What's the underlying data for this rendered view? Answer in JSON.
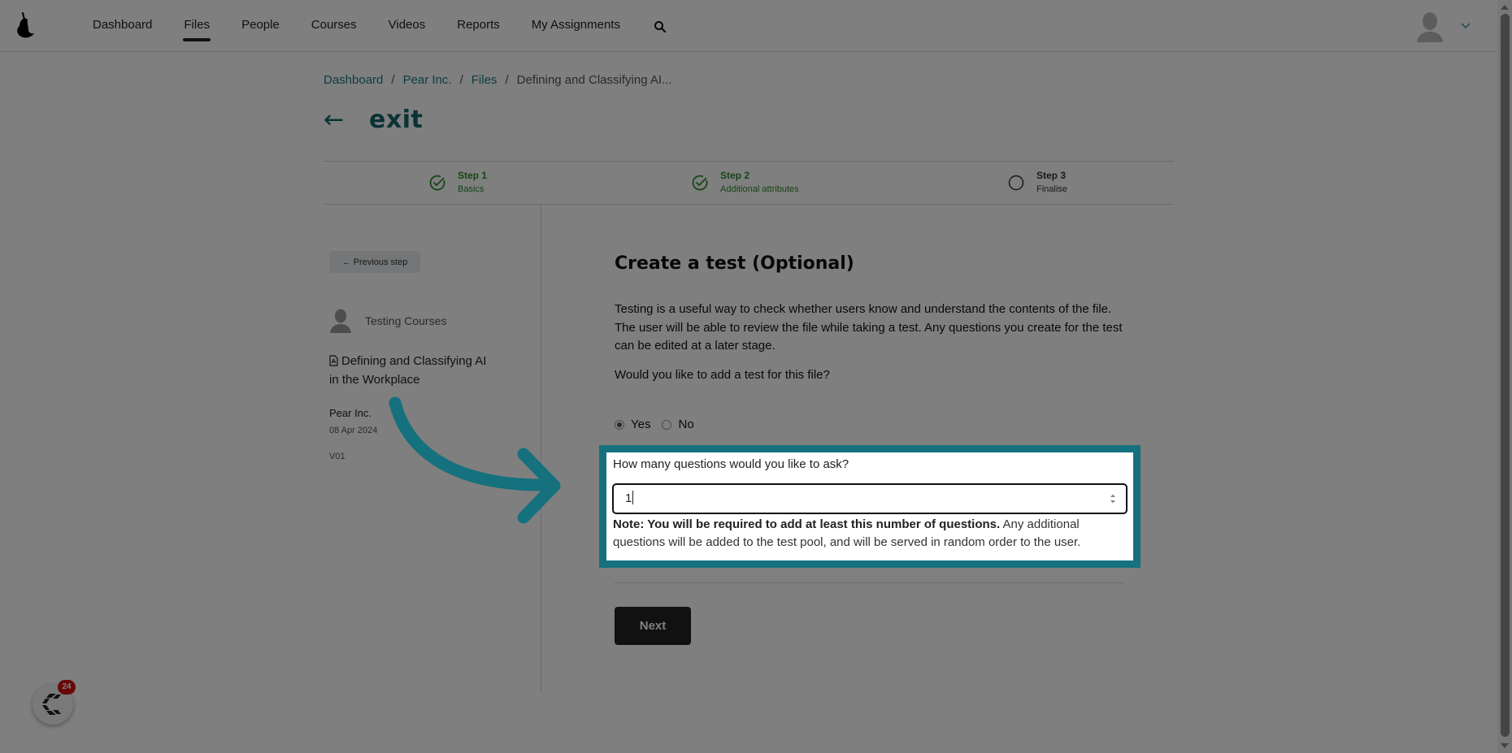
{
  "nav": {
    "items": [
      {
        "label": "Dashboard",
        "active": false
      },
      {
        "label": "Files",
        "active": true
      },
      {
        "label": "People",
        "active": false
      },
      {
        "label": "Courses",
        "active": false
      },
      {
        "label": "Videos",
        "active": false
      },
      {
        "label": "Reports",
        "active": false
      },
      {
        "label": "My Assignments",
        "active": false
      }
    ],
    "search_icon": "search-icon",
    "avatar_icon": "user-avatar-icon",
    "menu_icon": "chevron-down-icon"
  },
  "breadcrumb": {
    "items": [
      "Dashboard",
      "Pear Inc.",
      "Files"
    ],
    "current": "Defining and Classifying AI...",
    "separator": "/"
  },
  "exit": {
    "arrow": "←",
    "label": "exit"
  },
  "steps": [
    {
      "title": "Step 1",
      "subtitle": "Basics",
      "status": "complete"
    },
    {
      "title": "Step 2",
      "subtitle": "Additional attributes",
      "status": "complete"
    },
    {
      "title": "Step 3",
      "subtitle": "Finalise",
      "status": "pending"
    }
  ],
  "sidebar": {
    "previous_step_label": "← Previous step",
    "owner": "Testing Courses",
    "file_title": "Defining and Classifying AI in the Workplace",
    "organization": "Pear Inc.",
    "date": "08 Apr 2024",
    "version": "V01"
  },
  "main": {
    "heading": "Create a test (Optional)",
    "description": "Testing is a useful way to check whether users know and understand the contents of the file. The user will be able to review the file while taking a test. Any questions you create for the test can be edited at a later stage.",
    "question": "Would you like to add a test for this file?",
    "options": [
      {
        "label": "Yes",
        "checked": true
      },
      {
        "label": "No",
        "checked": false
      }
    ],
    "count_label": "How many questions would you like to ask?",
    "count_value": "1",
    "note_bold": "Note: You will be required to add at least this number of questions.",
    "note_rest": " Any additional questions will be added to the test pool, and will be served in random order to the user.",
    "next_label": "Next"
  },
  "chat_widget": {
    "badge_count": "24"
  },
  "colors": {
    "accent": "#15717d",
    "link": "#1a7b88",
    "step_complete": "#2b8a2b",
    "badge": "#d01010"
  }
}
